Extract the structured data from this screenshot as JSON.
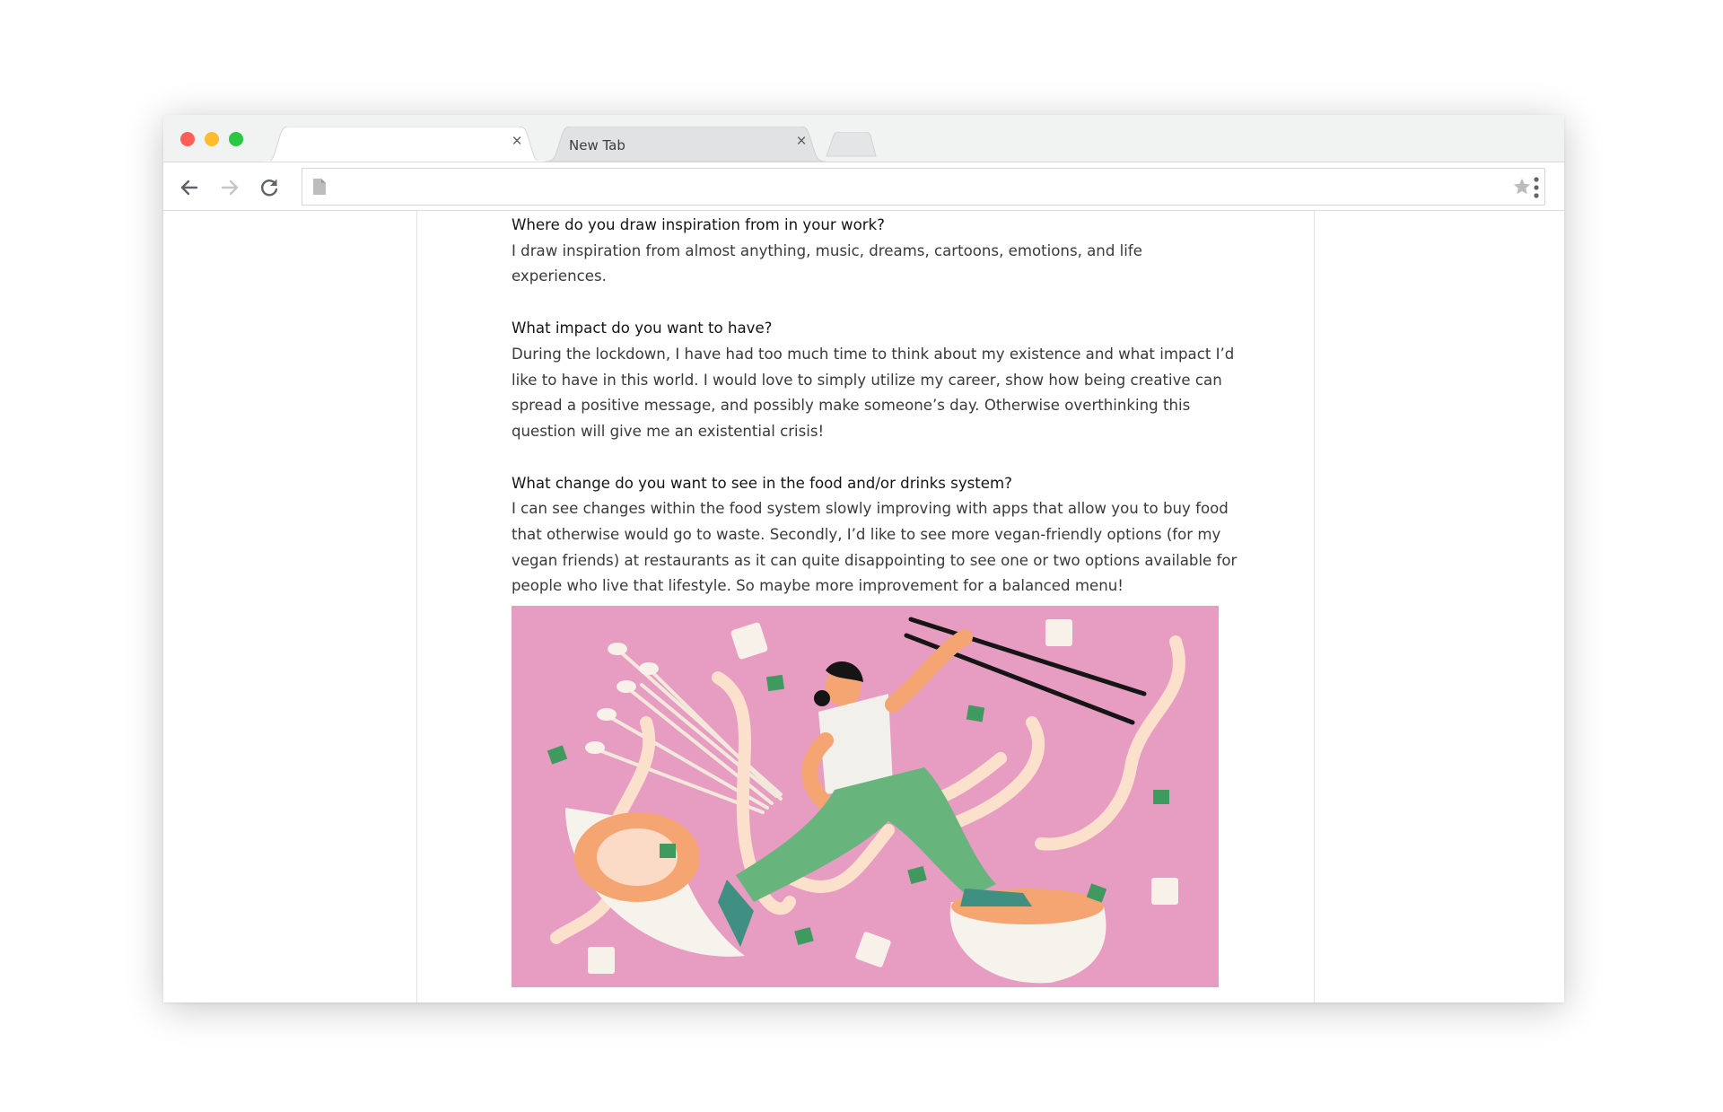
{
  "browser": {
    "tabs": [
      {
        "label": "",
        "active": true
      },
      {
        "label": "New Tab",
        "active": false
      }
    ],
    "address": {
      "value": ""
    },
    "colors": {
      "close": "#fe5f57",
      "minimize": "#febc2e",
      "maximize": "#28c840"
    }
  },
  "article": {
    "sections": [
      {
        "question": "Where do you draw inspiration from in your work?",
        "answer": "I draw inspiration from almost anything, music, dreams, cartoons, emotions, and life experiences."
      },
      {
        "question": "What impact do you want to have?",
        "answer": "During the lockdown, I have had too much time to think about my existence and what impact I’d like to have in this world. I would love to simply utilize my career, show how being creative can spread a positive message, and possibly make someone’s day. Otherwise overthinking this question will give me an existential crisis!"
      },
      {
        "question": "What change do you want to see in the food and/or drinks system?",
        "answer": "I can see changes within the food system slowly improving with apps that allow you to buy food that otherwise would go to waste. Secondly, I’d like to see more vegan-friendly options (for my vegan friends) at restaurants as it can quite disappointing to see one or two options available for people who live that lifestyle. So maybe more improvement for a balanced menu!"
      }
    ],
    "illustration": {
      "background": "#e79cc2"
    }
  }
}
